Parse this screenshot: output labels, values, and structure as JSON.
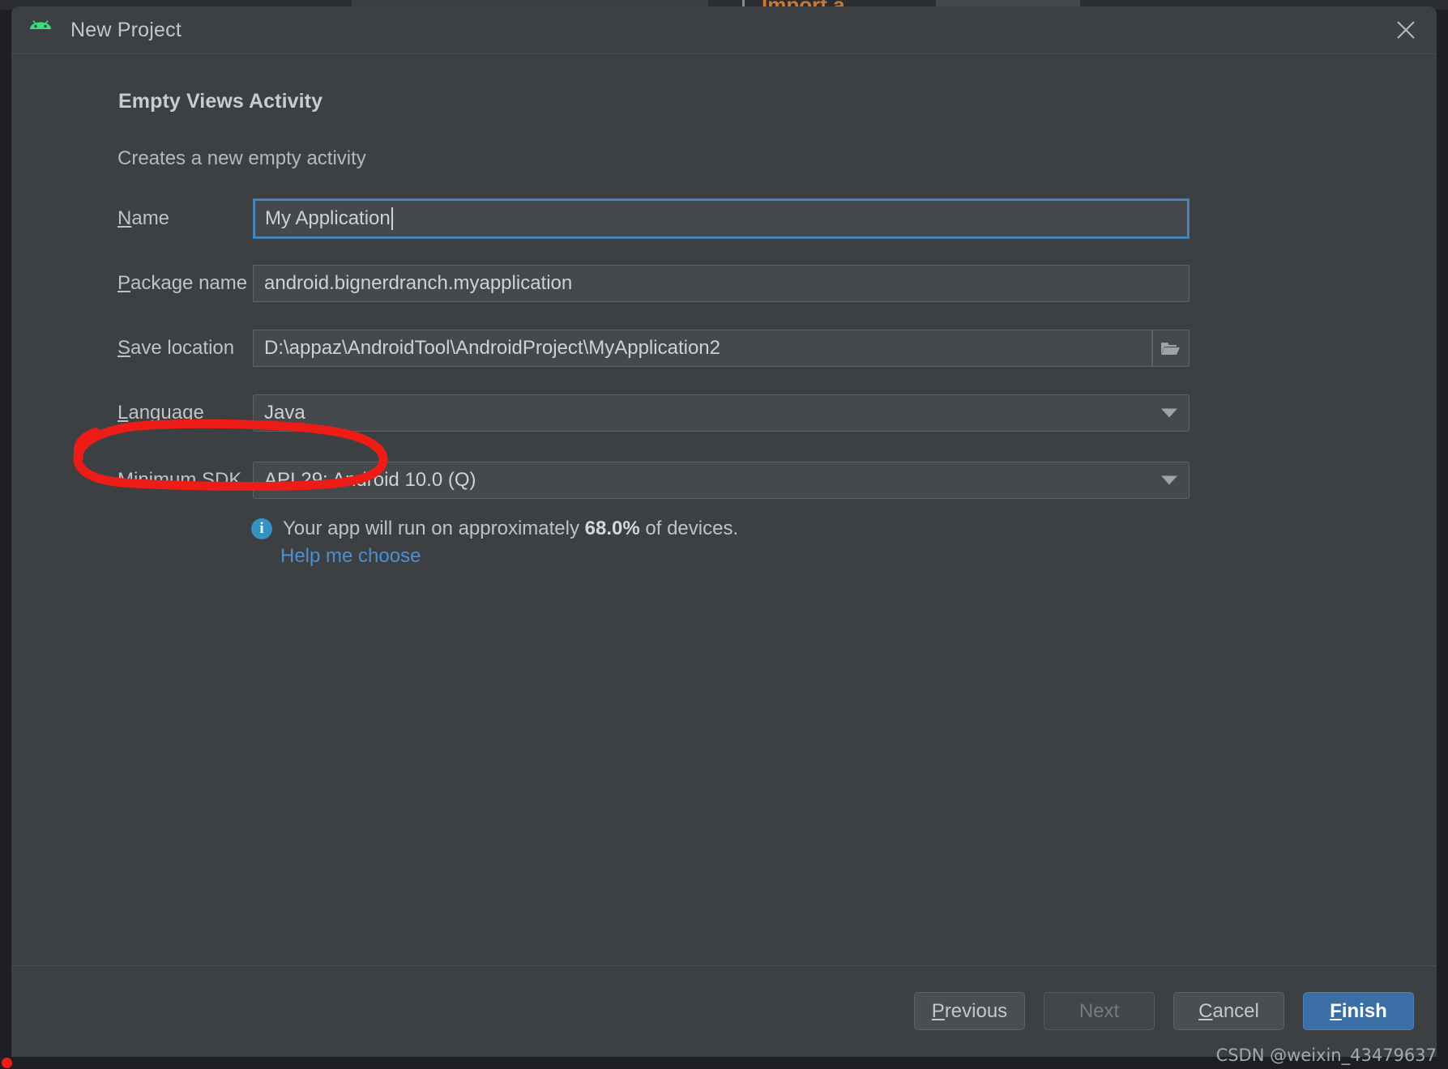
{
  "window": {
    "title": "New Project",
    "app_icon": "android-robot-icon",
    "close_icon": "close-icon"
  },
  "background": {
    "partial_tab_text": "Import a ..."
  },
  "content": {
    "heading": "Empty Views Activity",
    "subheading": "Creates a new empty activity"
  },
  "form": {
    "rows": [
      {
        "id": "name",
        "label_mnemonic": "N",
        "label_rest": "ame",
        "value": "My Application",
        "control": "text-input",
        "focused": true
      },
      {
        "id": "package-name",
        "label_mnemonic": "P",
        "label_rest": "ackage name",
        "value": "android.bignerdranch.myapplication",
        "control": "text-input",
        "focused": false
      },
      {
        "id": "save-location",
        "label_mnemonic": "S",
        "label_rest": "ave location",
        "value": "D:\\appaz\\AndroidTool\\AndroidProject\\MyApplication2",
        "control": "text-input-with-browse",
        "browse_icon": "folder-icon",
        "focused": false
      },
      {
        "id": "language",
        "label_mnemonic": "L",
        "label_rest": "anguage",
        "value": "Java",
        "control": "dropdown",
        "focused": false
      },
      {
        "id": "minimum-sdk",
        "label_mnemonic": "",
        "label_rest": "Minimum SDK",
        "value": "API 29: Android 10.0 (Q)",
        "control": "dropdown",
        "focused": false
      }
    ]
  },
  "info": {
    "icon": "info-icon",
    "text_before": "Your app will run on approximately ",
    "percent": "68.0%",
    "text_after": " of devices.",
    "help_link": "Help me choose"
  },
  "footer": {
    "buttons": [
      {
        "id": "previous",
        "mnemonic": "P",
        "rest": "revious",
        "state": "enabled"
      },
      {
        "id": "next",
        "mnemonic": "",
        "rest": "Next",
        "state": "disabled"
      },
      {
        "id": "cancel",
        "mnemonic": "C",
        "rest": "ancel",
        "state": "enabled"
      },
      {
        "id": "finish",
        "mnemonic": "F",
        "rest": "inish",
        "state": "default"
      }
    ]
  },
  "annotation": {
    "type": "hand-drawn-red-ellipse",
    "color": "#ee1c16",
    "targets": "Language label and Java dropdown"
  },
  "watermark": "CSDN @weixin_43479637",
  "colors": {
    "dialog_bg": "#3c4043",
    "field_bg": "#45494c",
    "field_border": "#5d6164",
    "focus_border": "#4887bf",
    "text": "#c0c2c4",
    "link": "#4b8fd1",
    "primary_button": "#3a6ea5",
    "info_badge": "#3592c4",
    "annotation_red": "#ee1c16",
    "android_green": "#3ddc84"
  }
}
